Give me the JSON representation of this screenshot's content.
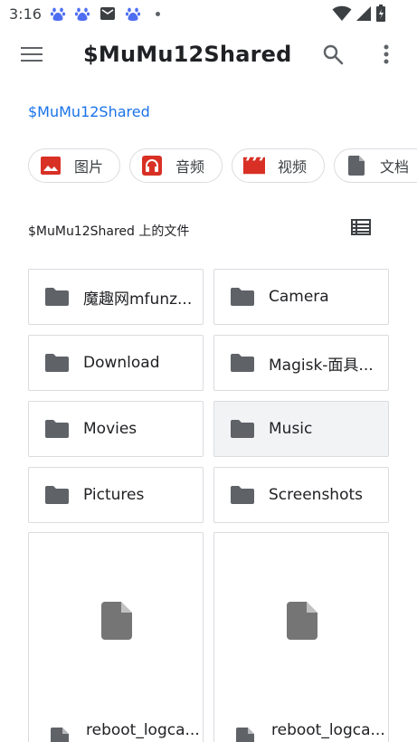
{
  "status_bar": {
    "time": "3:16",
    "notification_icons": [
      "baidu-icon",
      "baidu-icon",
      "mail-icon",
      "baidu-icon"
    ],
    "right_icons": [
      "wifi-icon",
      "signal-icon",
      "battery-icon"
    ]
  },
  "app_bar": {
    "title": "$MuMu12Shared",
    "menu_icon": "hamburger-menu-icon",
    "search_icon": "search-icon",
    "more_icon": "more-vert-icon"
  },
  "breadcrumb": {
    "current": "$MuMu12Shared"
  },
  "chips": [
    {
      "label": "图片",
      "icon": "image-icon",
      "color": "#d93025"
    },
    {
      "label": "音频",
      "icon": "headphones-icon",
      "color": "#d93025"
    },
    {
      "label": "视频",
      "icon": "movie-icon",
      "color": "#d93025"
    },
    {
      "label": "文档",
      "icon": "document-icon",
      "color": "#5f6368"
    }
  ],
  "section": {
    "title": "$MuMu12Shared 上的文件",
    "view_toggle_icon": "list-view-icon"
  },
  "folders": [
    {
      "name": "魔趣网mfunz..."
    },
    {
      "name": "Camera"
    },
    {
      "name": "Download"
    },
    {
      "name": "Magisk-面具..."
    },
    {
      "name": "Movies"
    },
    {
      "name": "Music",
      "selected": true
    },
    {
      "name": "Pictures"
    },
    {
      "name": "Screenshots"
    }
  ],
  "files": [
    {
      "name": "reboot_logca..."
    },
    {
      "name": "reboot_logca..."
    }
  ],
  "colors": {
    "accent": "#1a73e8",
    "icon_gray": "#5f6368",
    "chip_red": "#d93025",
    "border": "#dadce0"
  }
}
